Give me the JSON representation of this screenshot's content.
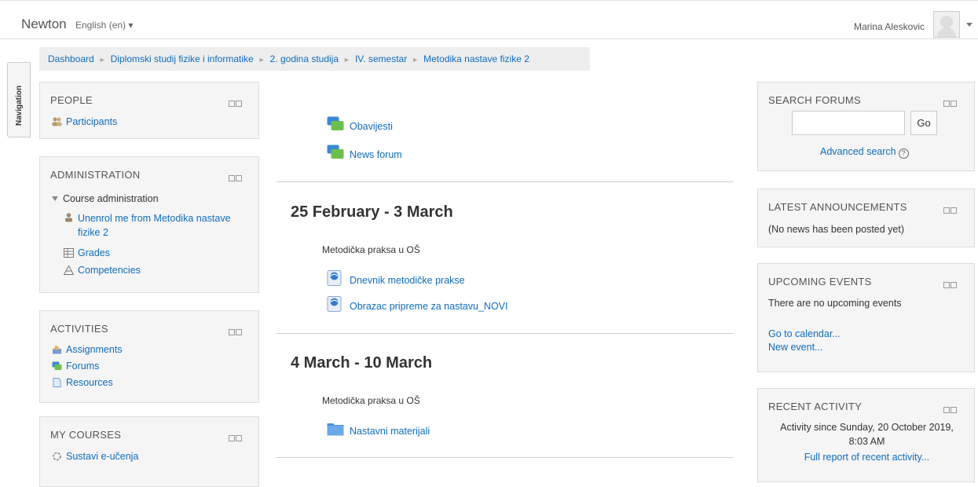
{
  "header": {
    "brand": "Newton",
    "language": "English (en) ▾",
    "user_name": "Marina Aleskovic"
  },
  "breadcrumb": [
    "Dashboard",
    "Diplomski studij fizike i informatike",
    "2. godina studija",
    "IV. semestar",
    "Metodika nastave fizike 2"
  ],
  "nav_tab": "Navigation",
  "people": {
    "title": "PEOPLE",
    "participants": "Participants"
  },
  "administration": {
    "title": "ADMINISTRATION",
    "course_admin": "Course administration",
    "unenrol_line1": "Unenrol me from Metodika nastave",
    "unenrol_line2": "fizike 2",
    "grades": "Grades",
    "competencies": "Competencies"
  },
  "activities": {
    "title": "ACTIVITIES",
    "assignments": "Assignments",
    "forums": "Forums",
    "resources": "Resources"
  },
  "my_courses": {
    "title": "MY COURSES",
    "item1": "Sustavi e-učenja"
  },
  "main": {
    "forum1": "Obavijesti",
    "forum2": "News forum",
    "section1": {
      "title": "25 February - 3 March",
      "summary": "Metodička praksa u OŠ",
      "res1": "Dnevnik metodičke prakse",
      "res2": "Obrazac pripreme za nastavu_NOVI"
    },
    "section2": {
      "title": "4 March - 10 March",
      "summary": "Metodička praksa u OŠ",
      "folder": "Nastavni materijali"
    }
  },
  "search_forums": {
    "title": "SEARCH FORUMS",
    "go": "Go",
    "advanced": "Advanced search"
  },
  "latest_announcements": {
    "title": "LATEST ANNOUNCEMENTS",
    "text": "(No news has been posted yet)"
  },
  "upcoming_events": {
    "title": "UPCOMING EVENTS",
    "text": "There are no upcoming events",
    "calendar": "Go to calendar...",
    "new_event": "New event..."
  },
  "recent_activity": {
    "title": "RECENT ACTIVITY",
    "line1": "Activity since Sunday, 20 October 2019,",
    "line2": "8:03 AM",
    "full_report": "Full report of recent activity..."
  }
}
